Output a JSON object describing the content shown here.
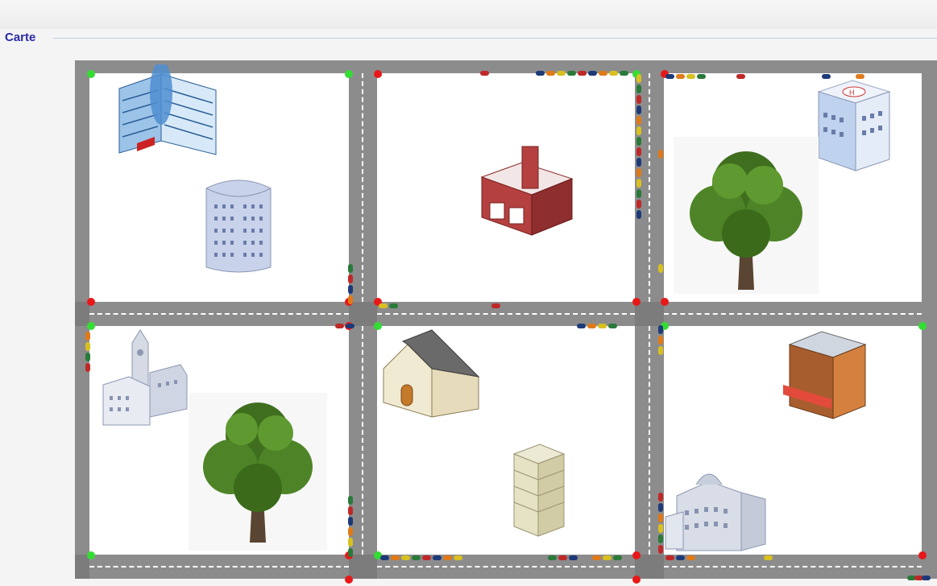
{
  "window": {
    "title": ""
  },
  "section": {
    "title": "Carte"
  },
  "palette": {
    "road": "#8c8c8c",
    "lane_marking": "#ffffff",
    "green_light": "#33dd33",
    "red_light": "#e81818",
    "block": "#ffffff",
    "title": "#2a2aa8"
  },
  "grid": {
    "columns": 3,
    "rows": 2
  },
  "blocks": [
    {
      "id": "r1c1",
      "contents": [
        "blue-office-building-icon",
        "glass-tower-icon"
      ]
    },
    {
      "id": "r1c2",
      "contents": [
        "fire-station-icon"
      ]
    },
    {
      "id": "r1c3",
      "contents": [
        "hospital-icon",
        "tree-icon"
      ]
    },
    {
      "id": "r2c1",
      "contents": [
        "clock-tower-building-icon",
        "tree-icon"
      ]
    },
    {
      "id": "r2c2",
      "contents": [
        "house-icon",
        "apartment-tower-icon"
      ]
    },
    {
      "id": "r2c3",
      "contents": [
        "shop-icon",
        "city-hall-icon"
      ]
    }
  ],
  "traffic_lights": {
    "green_count": 9,
    "red_count": 12
  },
  "car_colors": [
    "#1d3a78",
    "#e07a18",
    "#d8c020",
    "#2a7a3a",
    "#c02828"
  ]
}
